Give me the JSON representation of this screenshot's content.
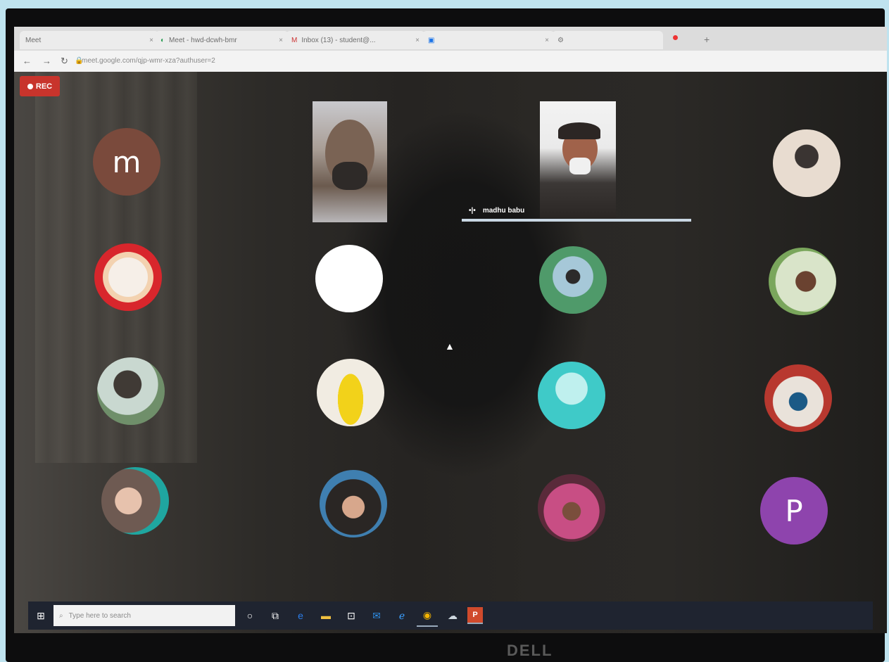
{
  "browser": {
    "tabs": [
      {
        "label": "Meet",
        "icon": "meet-tab-icon"
      },
      {
        "label": "Meet - hwd-dcwh-bmr",
        "icon": "meet-tab-icon"
      },
      {
        "label": "Inbox (13) - student@...",
        "icon": "gmail-tab-icon"
      },
      {
        "label": "",
        "icon": "calendar-tab-icon"
      }
    ],
    "url": "meet.google.com/qjp-wmr-xza?authuser=2"
  },
  "meeting": {
    "rec_label": "REC",
    "speaker_caption": "madhu babu",
    "participant_letters": {
      "m": "m",
      "p": "P"
    },
    "colors": {
      "m_avatar": "#7a4a3c",
      "p_avatar": "#8e44ad",
      "rec": "#c8342c"
    }
  },
  "taskbar": {
    "search_placeholder": "Type here to search"
  },
  "monitor": {
    "brand": "DELL"
  }
}
